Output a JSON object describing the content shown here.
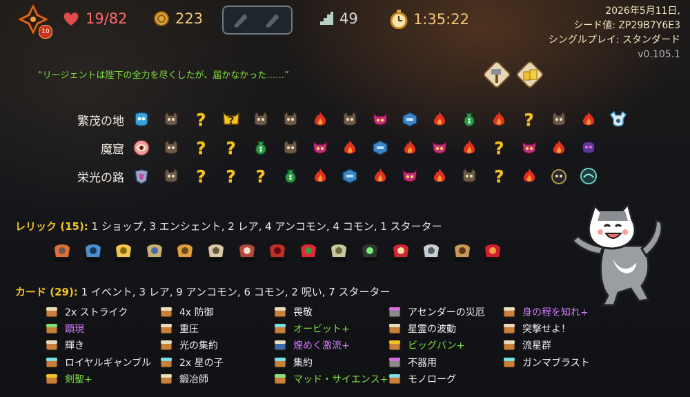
{
  "top_bar": {
    "character_level": "10",
    "hp": "19/82",
    "gold": "223",
    "floor": "49",
    "time": "1:35:22"
  },
  "run_info": {
    "date": "2026年5月11日,",
    "seed": "シード値: ZP29B7Y6E3",
    "mode": "シングルプレイ: スタンダード",
    "version": "v0.105.1"
  },
  "quote": "“リージェントは陛下の全力を尽くしたが、届かなかった……”",
  "acts": [
    {
      "name": "繁茂の地",
      "nodes": [
        "boss-start",
        "monster",
        "unknown",
        "unknown-elite",
        "monster",
        "monster",
        "elite",
        "monster",
        "elite-demon",
        "treasure",
        "elite",
        "merchant",
        "elite",
        "unknown",
        "monster",
        "elite",
        "boss"
      ]
    },
    {
      "name": "魔窟",
      "nodes": [
        "eye-boss",
        "monster",
        "unknown",
        "unknown",
        "merchant",
        "monster",
        "elite-demon",
        "elite",
        "treasure",
        "elite",
        "elite-demon",
        "elite",
        "unknown",
        "elite-demon",
        "elite",
        "boss-purple"
      ]
    },
    {
      "name": "栄光の路",
      "nodes": [
        "wing-boss",
        "monster",
        "unknown",
        "unknown",
        "unknown",
        "merchant",
        "elite",
        "treasure",
        "elite",
        "elite-demon",
        "elite",
        "monster",
        "unknown",
        "elite",
        "boss-dark",
        "boss-teal"
      ]
    }
  ],
  "relics": {
    "label": "レリック (15):",
    "summary": "1 ショップ,  3 エンシェント, 2 レア, 4 アンコモン, 4 コモン, 1 スターター",
    "items": [
      "ember-rock",
      "blue-chest",
      "golden-bow",
      "hourglass",
      "orrery",
      "bone-horn",
      "meat-on-bone",
      "red-mailbox",
      "strawberry",
      "newtons-cradle",
      "lantern",
      "red-scarf",
      "tuning-fork",
      "chess-knight",
      "red-potion"
    ]
  },
  "cards": {
    "label": "カード (29):",
    "summary": "1 イベント, 3 レア, 9 アンコモン, 6 コモン, 2 呪い, 7 スターター",
    "columns": [
      [
        {
          "name": "2x ストライク",
          "color": "white",
          "icon": "common"
        },
        {
          "name": "顕現",
          "color": "purple",
          "icon": "rare-green"
        },
        {
          "name": "輝き",
          "color": "white",
          "icon": "common"
        },
        {
          "name": "ロイヤルギャンブル",
          "color": "white",
          "icon": "uncommon"
        },
        {
          "name": "剣聖+",
          "color": "green",
          "icon": "rare"
        }
      ],
      [
        {
          "name": "4x 防御",
          "color": "white",
          "icon": "common"
        },
        {
          "name": "重圧",
          "color": "white",
          "icon": "common"
        },
        {
          "name": "光の集約",
          "color": "white",
          "icon": "common"
        },
        {
          "name": "2x 星の子",
          "color": "white",
          "icon": "uncommon"
        },
        {
          "name": "鍛冶師",
          "color": "white",
          "icon": "common"
        }
      ],
      [
        {
          "name": "畏敬",
          "color": "white",
          "icon": "common"
        },
        {
          "name": "オービット+",
          "color": "green",
          "icon": "uncommon"
        },
        {
          "name": "煌めく激流+",
          "color": "purple",
          "icon": "common-blue"
        },
        {
          "name": "集約",
          "color": "white",
          "icon": "uncommon"
        },
        {
          "name": "マッド・サイエンス+",
          "color": "green",
          "icon": "event"
        }
      ],
      [
        {
          "name": "アセンダーの災厄",
          "color": "white",
          "icon": "curse"
        },
        {
          "name": "星霊の波動",
          "color": "white",
          "icon": "common"
        },
        {
          "name": "ビッグバン+",
          "color": "green",
          "icon": "rare"
        },
        {
          "name": "不器用",
          "color": "white",
          "icon": "curse"
        },
        {
          "name": "モノローグ",
          "color": "white",
          "icon": "uncommon"
        }
      ],
      [
        {
          "name": "身の程を知れ+",
          "color": "purple",
          "icon": "common-figure"
        },
        {
          "name": "突撃せよ！",
          "color": "white",
          "icon": "common-figure"
        },
        {
          "name": "流星群",
          "color": "white",
          "icon": "common"
        },
        {
          "name": "ガンマブラスト",
          "color": "white",
          "icon": "uncommon"
        }
      ]
    ]
  },
  "colors": {
    "hp": "#ff6b6b",
    "gold": "#f3c97a",
    "quote": "#7fe03e",
    "unknown": "#f3c420",
    "upgraded_card": "#7fe03e",
    "special_card": "#d57bff"
  }
}
